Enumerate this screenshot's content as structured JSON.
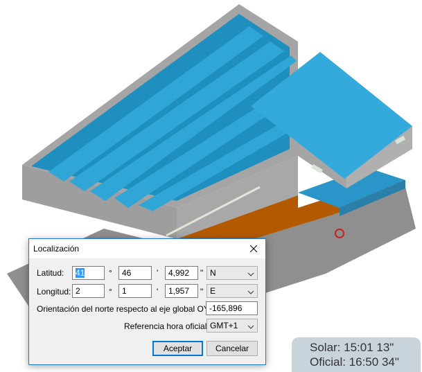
{
  "dialog": {
    "title": "Localización",
    "latitude": {
      "label": "Latitud:",
      "degrees": "41",
      "degree_symbol": "°",
      "minutes": "46",
      "minute_symbol": "'",
      "seconds": "4,992",
      "second_symbol": "\"",
      "hemisphere": "N"
    },
    "longitude": {
      "label": "Longitud:",
      "degrees": "2",
      "degree_symbol": "°",
      "minutes": "1",
      "minute_symbol": "'",
      "seconds": "1,957",
      "second_symbol": "\"",
      "hemisphere": "E"
    },
    "orientation": {
      "label": "Orientación del norte respecto al eje global OY (°):",
      "value": "-165,896"
    },
    "timezone": {
      "label": "Referencia hora oficial:",
      "value": "GMT+1"
    },
    "accept_label": "Aceptar",
    "cancel_label": "Cancelar"
  },
  "time_panel": {
    "solar": "Solar: 15:01 13\"",
    "official": "Oficial: 16:50 34\""
  },
  "colors": {
    "dialog_border": "#1e78d0",
    "roof_blue": "#2ea8d8",
    "wall_gray": "#9a9a9a",
    "floor_orange": "#b35a00"
  }
}
